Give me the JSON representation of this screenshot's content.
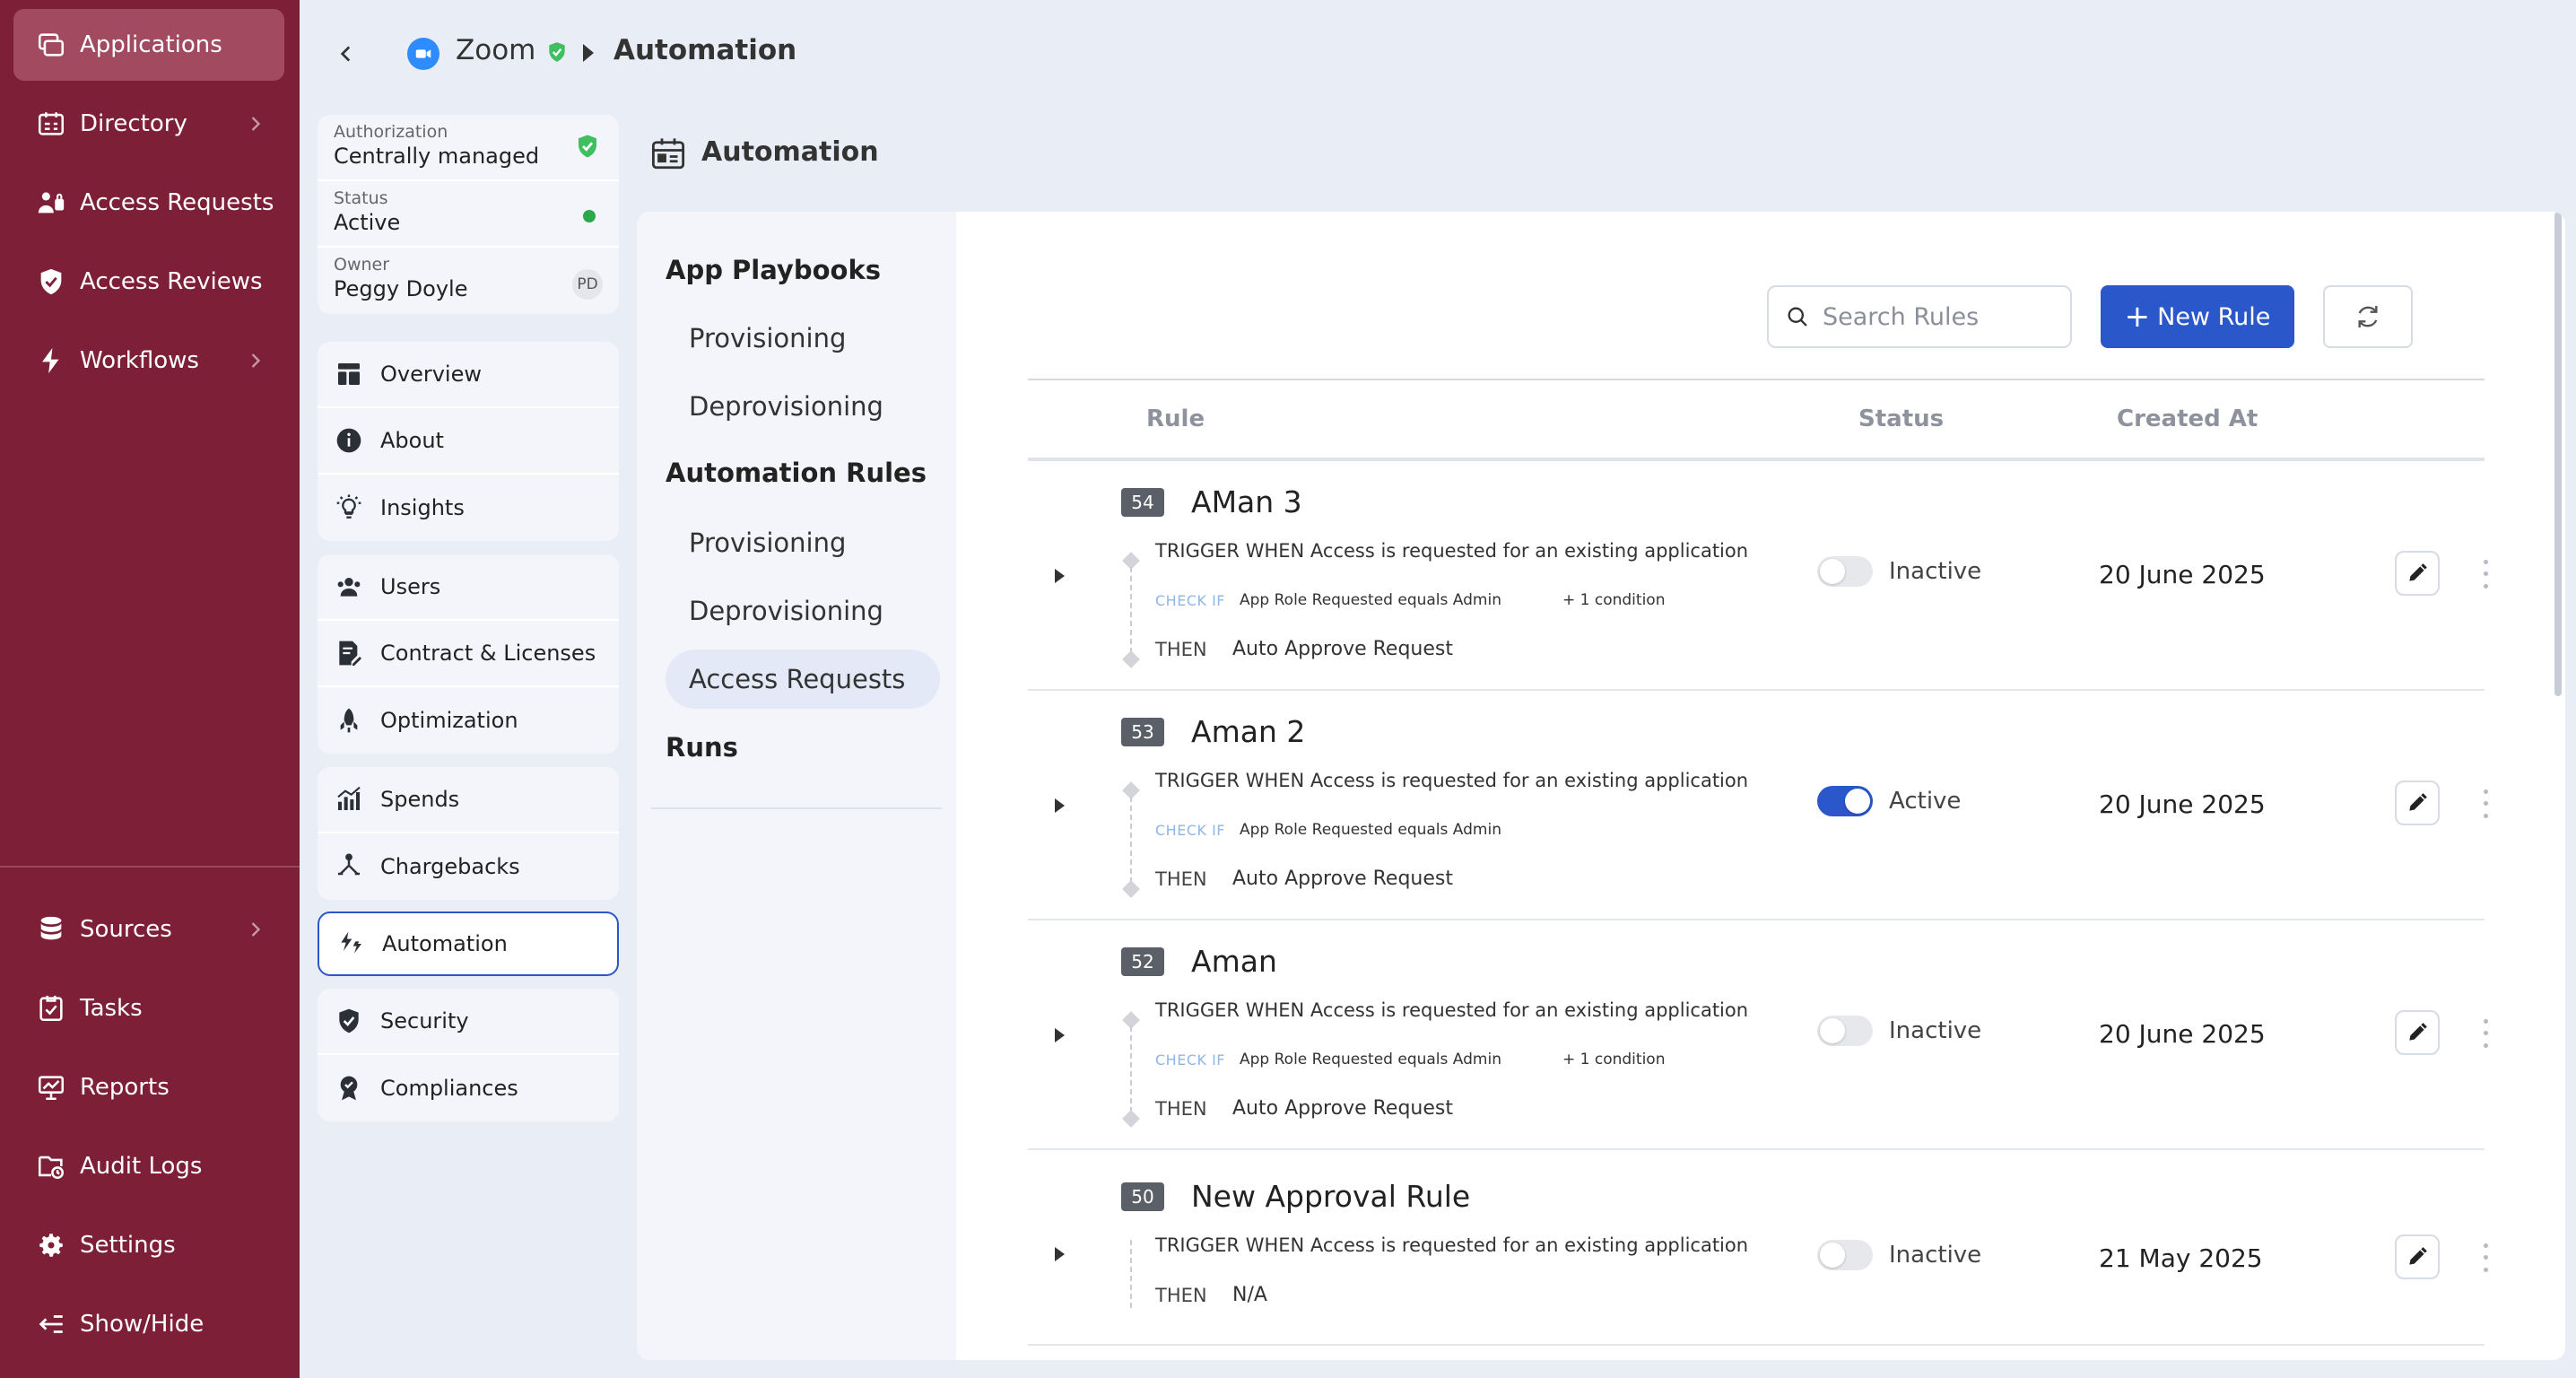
{
  "sidebar": {
    "top_items": [
      {
        "label": "Applications",
        "icon": "applications-icon",
        "active": true,
        "chevron": false
      },
      {
        "label": "Directory",
        "icon": "directory-icon",
        "active": false,
        "chevron": true
      },
      {
        "label": "Access Requests",
        "icon": "access-requests-icon",
        "active": false,
        "chevron": false
      },
      {
        "label": "Access Reviews",
        "icon": "access-reviews-icon",
        "active": false,
        "chevron": false
      },
      {
        "label": "Workflows",
        "icon": "workflows-icon",
        "active": false,
        "chevron": true
      }
    ],
    "bottom_items": [
      {
        "label": "Sources",
        "icon": "sources-icon",
        "chevron": true
      },
      {
        "label": "Tasks",
        "icon": "tasks-icon",
        "chevron": false
      },
      {
        "label": "Reports",
        "icon": "reports-icon",
        "chevron": false
      },
      {
        "label": "Audit Logs",
        "icon": "audit-logs-icon",
        "chevron": false
      },
      {
        "label": "Settings",
        "icon": "settings-icon",
        "chevron": false
      },
      {
        "label": "Show/Hide",
        "icon": "show-hide-icon",
        "chevron": false
      }
    ]
  },
  "breadcrumb": {
    "app": "Zoom",
    "current": "Automation"
  },
  "app_info": {
    "authorization_key": "Authorization",
    "authorization_value": "Centrally managed",
    "status_key": "Status",
    "status_value": "Active",
    "owner_key": "Owner",
    "owner_value": "Peggy Doyle",
    "owner_initials": "PD"
  },
  "app_nav": {
    "group1": [
      "Overview",
      "About",
      "Insights"
    ],
    "group2": [
      "Users",
      "Contract & Licenses",
      "Optimization"
    ],
    "group3": [
      "Spends",
      "Chargebacks"
    ],
    "selected": "Automation",
    "group4": [
      "Security",
      "Compliances"
    ]
  },
  "section": {
    "title": "Automation"
  },
  "playbook_nav": {
    "app_playbooks": "App Playbooks",
    "app_playbooks_items": [
      "Provisioning",
      "Deprovisioning"
    ],
    "automation_rules": "Automation Rules",
    "automation_rules_items": [
      "Provisioning",
      "Deprovisioning",
      "Access Requests"
    ],
    "selected_item": "Access Requests",
    "runs": "Runs"
  },
  "toolbar": {
    "search_placeholder": "Search Rules",
    "new_rule_label": "New Rule"
  },
  "table": {
    "columns": [
      "Rule",
      "Status",
      "Created At"
    ],
    "rows": [
      {
        "id": "54",
        "name": "AMan 3",
        "trigger": "TRIGGER WHEN Access is requested for an existing application",
        "check_label": "CHECK IF",
        "condition": "App Role Requested equals Admin",
        "extra": "+ 1 condition",
        "then_label": "THEN",
        "then_value": "Auto Approve Request",
        "active": false,
        "status": "Inactive",
        "created": "20 June 2025"
      },
      {
        "id": "53",
        "name": "Aman 2",
        "trigger": "TRIGGER WHEN Access is requested for an existing application",
        "check_label": "CHECK IF",
        "condition": "App Role Requested equals Admin",
        "extra": "",
        "then_label": "THEN",
        "then_value": "Auto Approve Request",
        "active": true,
        "status": "Active",
        "created": "20 June 2025"
      },
      {
        "id": "52",
        "name": "Aman",
        "trigger": "TRIGGER WHEN Access is requested for an existing application",
        "check_label": "CHECK IF",
        "condition": "App Role Requested equals Admin",
        "extra": "+ 1 condition",
        "then_label": "THEN",
        "then_value": "Auto Approve Request",
        "active": false,
        "status": "Inactive",
        "created": "20 June 2025"
      },
      {
        "id": "50",
        "name": "New Approval Rule",
        "trigger": "TRIGGER WHEN Access is requested for an existing application",
        "check_label": "",
        "condition": "",
        "extra": "",
        "then_label": "THEN",
        "then_value": "N/A",
        "active": false,
        "status": "Inactive",
        "created": "21 May 2025"
      }
    ]
  },
  "colors": {
    "sidebar_bg": "#7d1f36",
    "sidebar_active": "#a24a60",
    "accent": "#2a57c9",
    "status_active": "#2aa84a"
  }
}
